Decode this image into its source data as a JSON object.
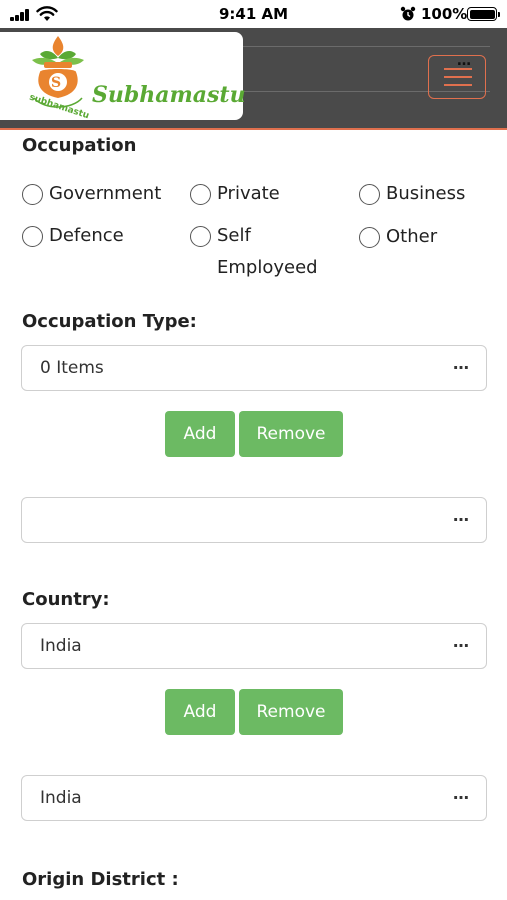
{
  "status_bar": {
    "time": "9:41 AM",
    "battery": "100%"
  },
  "header": {
    "brand": "Subhamastu",
    "logo_letter": "S",
    "logo_arc_text": "subhamastu",
    "ghost_field_dots": "…",
    "accent_color": "#e0704e"
  },
  "occupation": {
    "label": "Occupation",
    "options": [
      "Government",
      "Private",
      "Business",
      "Defence",
      "Self\nEmployeed",
      "Other"
    ]
  },
  "occupation_type": {
    "label": "Occupation Type:",
    "select_value": "0 Items",
    "dots": "…",
    "add_label": "Add",
    "remove_label": "Remove",
    "second_select_value": "",
    "second_dots": "…"
  },
  "country": {
    "label": "Country:",
    "select_value": "India",
    "dots": "…",
    "add_label": "Add",
    "remove_label": "Remove",
    "second_select_value": "India",
    "second_dots": "…"
  },
  "origin_district": {
    "label": "Origin District :"
  },
  "colors": {
    "button_green": "#6cba63",
    "header_bg": "#4a4a4a",
    "brand_green": "#5aa934"
  }
}
